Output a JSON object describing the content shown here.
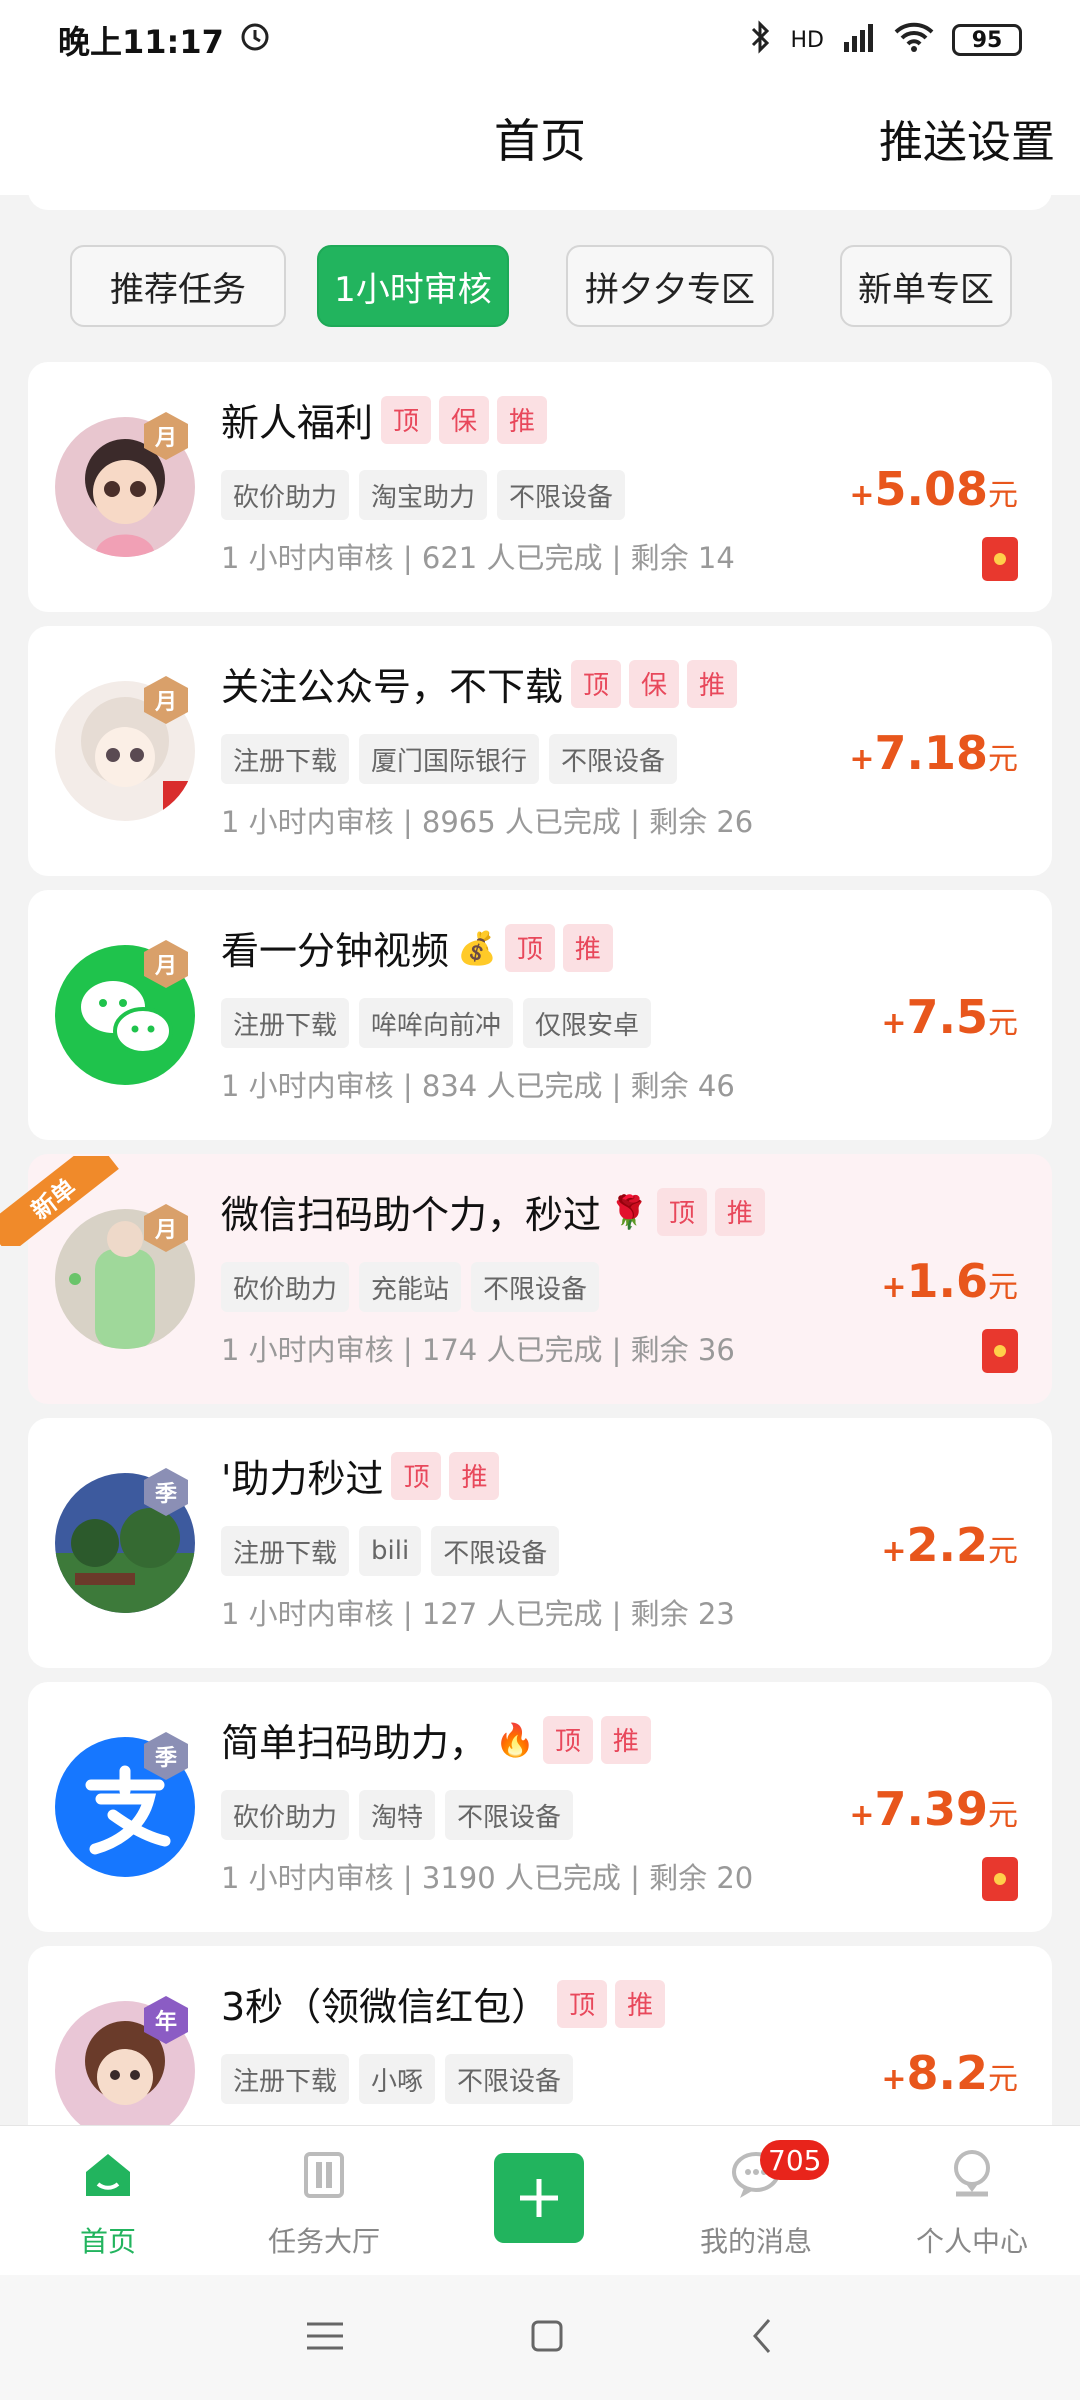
{
  "status_bar": {
    "time": "晚上11:17",
    "network": "HD",
    "battery": "95"
  },
  "header": {
    "title": "首页",
    "right_action": "推送设置"
  },
  "tabs": [
    {
      "label": "推荐任务",
      "active": false
    },
    {
      "label": "1小时审核",
      "active": true
    },
    {
      "label": "拼夕夕专区",
      "active": false
    },
    {
      "label": "新单专区",
      "active": false
    }
  ],
  "tasks": [
    {
      "title": "新人福利",
      "emoji": "",
      "badges": [
        "顶",
        "保",
        "推"
      ],
      "level": "月",
      "chips": [
        "砍价助力",
        "淘宝助力",
        "不限设备"
      ],
      "meta": "1 小时内审核 | 621 人已完成 | 剩余 14",
      "plus": "+",
      "amount": "5.08",
      "unit": "元",
      "red_packet": true,
      "new_ribbon": false
    },
    {
      "title": "关注公众号，不下载",
      "emoji": "",
      "badges": [
        "顶",
        "保",
        "推"
      ],
      "level": "月",
      "chips": [
        "注册下载",
        "厦门国际银行",
        "不限设备"
      ],
      "meta": "1 小时内审核 | 8965 人已完成 | 剩余 26",
      "plus": "+",
      "amount": "7.18",
      "unit": "元",
      "red_packet": false,
      "new_ribbon": false
    },
    {
      "title": "看一分钟视频",
      "emoji": "💰",
      "badges": [
        "顶",
        "推"
      ],
      "level": "月",
      "chips": [
        "注册下载",
        "哞哞向前冲",
        "仅限安卓"
      ],
      "meta": "1 小时内审核 | 834 人已完成 | 剩余 46",
      "plus": "+",
      "amount": "7.5",
      "unit": "元",
      "red_packet": false,
      "new_ribbon": false
    },
    {
      "title": "微信扫码助个力，秒过",
      "emoji": "🌹",
      "badges": [
        "顶",
        "推"
      ],
      "level": "月",
      "chips": [
        "砍价助力",
        "充能站",
        "不限设备"
      ],
      "meta": "1 小时内审核 | 174 人已完成 | 剩余 36",
      "plus": "+",
      "amount": "1.6",
      "unit": "元",
      "red_packet": true,
      "new_ribbon": true,
      "ribbon_label": "新单"
    },
    {
      "title": "'助力秒过",
      "emoji": "",
      "badges": [
        "顶",
        "推"
      ],
      "level": "季",
      "chips": [
        "注册下载",
        "bili",
        "不限设备"
      ],
      "meta": "1 小时内审核 | 127 人已完成 | 剩余 23",
      "plus": "+",
      "amount": "2.2",
      "unit": "元",
      "red_packet": false,
      "new_ribbon": false
    },
    {
      "title": "简单扫码助力，",
      "emoji": "🔥",
      "badges": [
        "顶",
        "推"
      ],
      "level": "季",
      "chips": [
        "砍价助力",
        "淘特",
        "不限设备"
      ],
      "meta": "1 小时内审核 | 3190 人已完成 | 剩余 20",
      "plus": "+",
      "amount": "7.39",
      "unit": "元",
      "red_packet": true,
      "new_ribbon": false
    },
    {
      "title": "3秒（领微信红包）",
      "emoji": "",
      "badges": [
        "顶",
        "推"
      ],
      "level": "年",
      "chips": [
        "注册下载",
        "小啄",
        "不限设备"
      ],
      "meta": "",
      "plus": "+",
      "amount": "8.2",
      "unit": "元",
      "red_packet": false,
      "new_ribbon": false
    }
  ],
  "bottom_nav": {
    "home": "首页",
    "hall": "任务大厅",
    "messages": "我的消息",
    "messages_badge": "705",
    "profile": "个人中心"
  },
  "colors": {
    "accent": "#22b45e",
    "price": "#e8561c",
    "badge_bg": "#fbe0e3",
    "badge_text": "#e8485b"
  }
}
